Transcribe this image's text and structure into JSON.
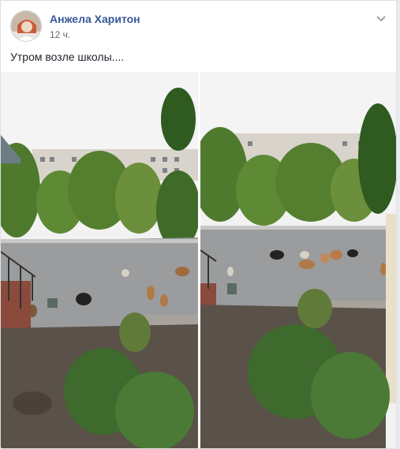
{
  "post": {
    "author": "Анжела Харитон",
    "time": "12 ч.",
    "text": "Утром возле школы....",
    "menu_icon": "chevron-down-icon",
    "photos": [
      {
        "name": "photo-left"
      },
      {
        "name": "photo-right"
      }
    ]
  },
  "colors": {
    "link": "#365899",
    "text": "#1d2129",
    "meta": "#616770"
  }
}
